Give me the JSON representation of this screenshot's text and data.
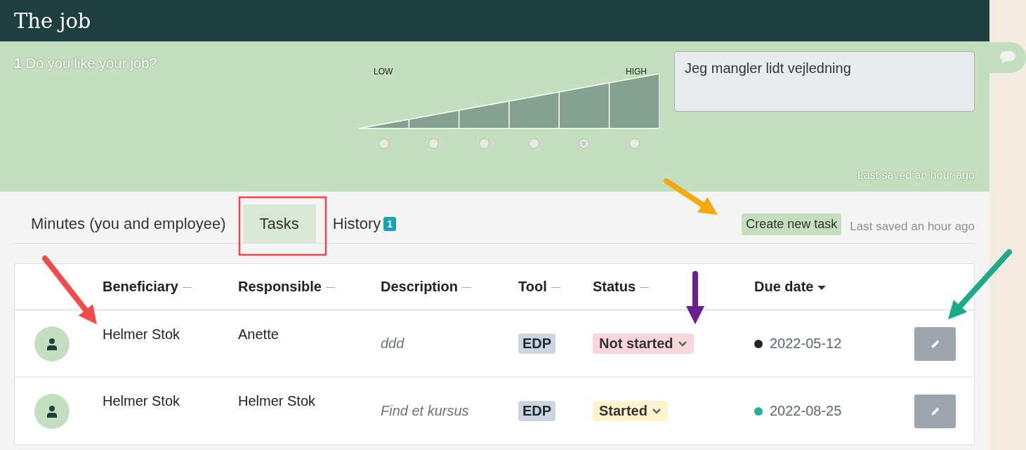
{
  "window": {
    "title": "The job"
  },
  "question": {
    "text": "**1** Do you like your job?",
    "scale": {
      "low_label": "LOW",
      "high_label": "HIGH",
      "options": [
        {
          "selected": false
        },
        {
          "selected": false
        },
        {
          "selected": false
        },
        {
          "selected": false
        },
        {
          "selected": true
        },
        {
          "selected": false
        }
      ]
    },
    "answer": {
      "value": "Jeg mangler lidt vejledning"
    },
    "save_status": "Last saved an hour ago"
  },
  "tabs": [
    {
      "label": "Minutes (you and employee)",
      "selected": false
    },
    {
      "label": "Tasks",
      "selected": true
    },
    {
      "label": "History",
      "selected": false,
      "badge": "1"
    }
  ],
  "create_button": "Create new task",
  "save_status": "Last saved an hour ago",
  "table": {
    "columns": [
      {
        "label": "Beneficiary",
        "sorted": false
      },
      {
        "label": "Responsible",
        "sorted": false
      },
      {
        "label": "Description",
        "sorted": false
      },
      {
        "label": "Tool",
        "sorted": false
      },
      {
        "label": "Status",
        "sorted": false
      },
      {
        "label": "Due date",
        "sorted": true
      }
    ],
    "rows": [
      {
        "beneficiary": "Helmer Stok",
        "responsible": "Anette",
        "description": "ddd",
        "tool": "EDP",
        "status": {
          "label": "Not started",
          "color": "#f8d7da"
        },
        "due_date": {
          "text": "2022-05-12",
          "color": "#212529"
        }
      },
      {
        "beneficiary": "Helmer Stok",
        "responsible": "Helmer Stok",
        "description": "Find et kursus",
        "tool": "EDP",
        "status": {
          "label": "Started",
          "color": "#fff3cd"
        },
        "due_date": {
          "text": "2022-08-25",
          "color": "#20b39a"
        }
      }
    ]
  }
}
